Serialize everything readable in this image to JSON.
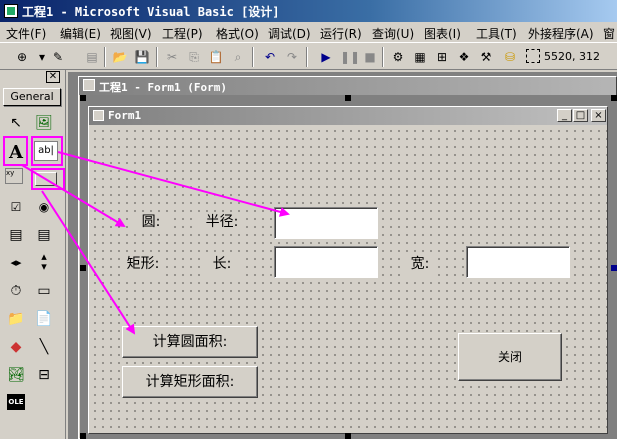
{
  "window": {
    "title": "工程1 - Microsoft Visual Basic [设计]",
    "icon": "vb-app-icon"
  },
  "menu": [
    {
      "label": "文件(F)"
    },
    {
      "label": "编辑(E)"
    },
    {
      "label": "视图(V)"
    },
    {
      "label": "工程(P)"
    },
    {
      "label": "格式(O)"
    },
    {
      "label": "调试(D)"
    },
    {
      "label": "运行(R)"
    },
    {
      "label": "查询(U)"
    },
    {
      "label": "图表(I)"
    },
    {
      "label": "工具(T)"
    },
    {
      "label": "外接程序(A)"
    },
    {
      "label": "窗"
    }
  ],
  "toolbar": {
    "coords": "5520, 312",
    "icons": [
      "add-project-icon",
      "add-form-icon",
      "menu-editor-icon",
      "open-icon",
      "save-icon",
      "cut-icon",
      "copy-icon",
      "paste-icon",
      "find-icon",
      "undo-icon",
      "redo-icon",
      "start-icon",
      "break-icon",
      "end-icon",
      "project-explorer-icon",
      "properties-icon",
      "form-layout-icon",
      "object-browser-icon",
      "toolbox-icon",
      "data-view-icon",
      "position-icon"
    ]
  },
  "toolbox": {
    "close": "✕",
    "tab": "General",
    "tools": [
      "pointer-icon",
      "picturebox-icon",
      "label-icon",
      "textbox-icon",
      "frame-icon",
      "commandbutton-icon",
      "checkbox-icon",
      "optionbutton-icon",
      "combobox-icon",
      "listbox-icon",
      "hscrollbar-icon",
      "vscrollbar-icon",
      "timer-icon",
      "drivelistbox-icon",
      "dirlistbox-icon",
      "filelistbox-icon",
      "shape-icon",
      "line-icon",
      "image-icon",
      "data-icon",
      "ole-icon"
    ],
    "label_glyph": "A",
    "textbox_glyph": "ab|",
    "frame_glyph": "xy",
    "ole_glyph": "OLE"
  },
  "project_window": {
    "title": "工程1 - Form1 (Form)"
  },
  "form": {
    "title": "Form1",
    "controls": {
      "circle_label": "圆:",
      "radius_label": "半径:",
      "rect_label": "矩形:",
      "length_label": "长:",
      "width_label": "宽:",
      "calc_circle_button": "计算圆面积:",
      "calc_rect_button": "计算矩形面积:",
      "close_button": "关闭"
    },
    "window_buttons": {
      "minimize": "_",
      "maximize": "□",
      "close": "×"
    }
  },
  "annotations": {
    "highlight_color": "#ff00ff"
  }
}
